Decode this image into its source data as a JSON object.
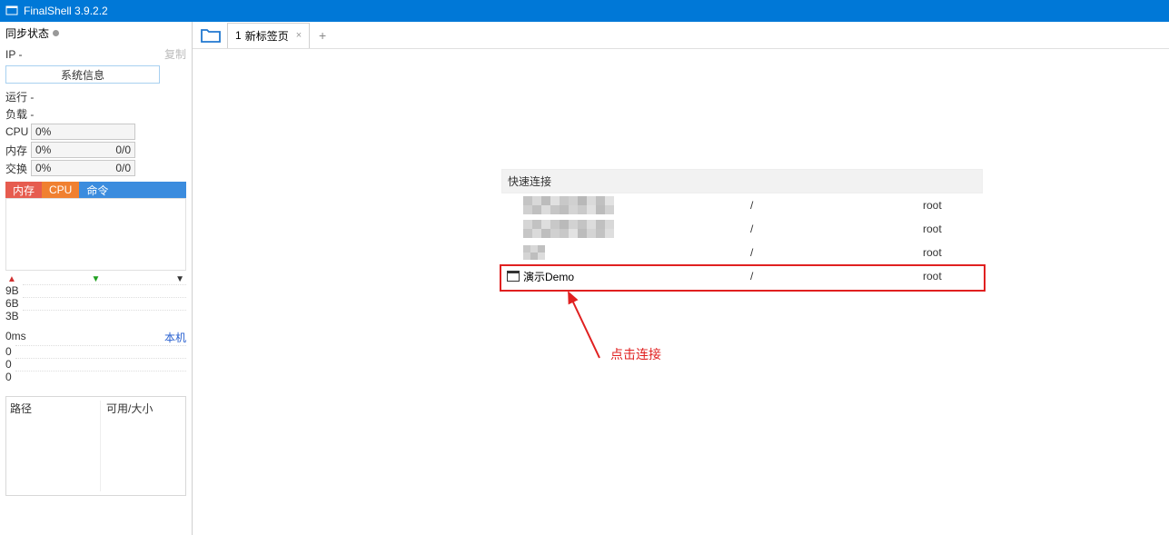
{
  "window": {
    "title": "FinalShell 3.9.2.2"
  },
  "sidebar": {
    "sync_label": "同步状态",
    "ip_label": "IP  -",
    "copy_label": "复制",
    "sys_info_btn": "系统信息",
    "run_label": "运行 -",
    "load_label": "负载 -",
    "cpu_label": "CPU",
    "cpu_value": "0%",
    "mem_label": "内存",
    "mem_value": "0%",
    "mem_ratio": "0/0",
    "swap_label": "交换",
    "swap_value": "0%",
    "swap_ratio": "0/0",
    "tabs": {
      "mem": "内存",
      "cpu": "CPU",
      "cmd": "命令"
    },
    "graph_y": {
      "a": "9B",
      "b": "6B",
      "c": "3B"
    },
    "latency_value": "0ms",
    "local_label": "本机",
    "latency_y": {
      "a": "0",
      "b": "0",
      "c": "0"
    },
    "disk_col1": "路径",
    "disk_col2": "可用/大小"
  },
  "tabs": {
    "page1_index": "1",
    "page1_label": "新标签页"
  },
  "quick": {
    "header": "快速连接",
    "rows": [
      {
        "name": "",
        "path": "/",
        "user": "root",
        "blurred": true
      },
      {
        "name": "",
        "path": "/",
        "user": "root",
        "blurred": true
      },
      {
        "name": "",
        "path": "/",
        "user": "root",
        "blurred": true
      },
      {
        "name": "演示Demo",
        "path": "/",
        "user": "root",
        "blurred": false
      }
    ]
  },
  "annotation": {
    "text": "点击连接"
  }
}
